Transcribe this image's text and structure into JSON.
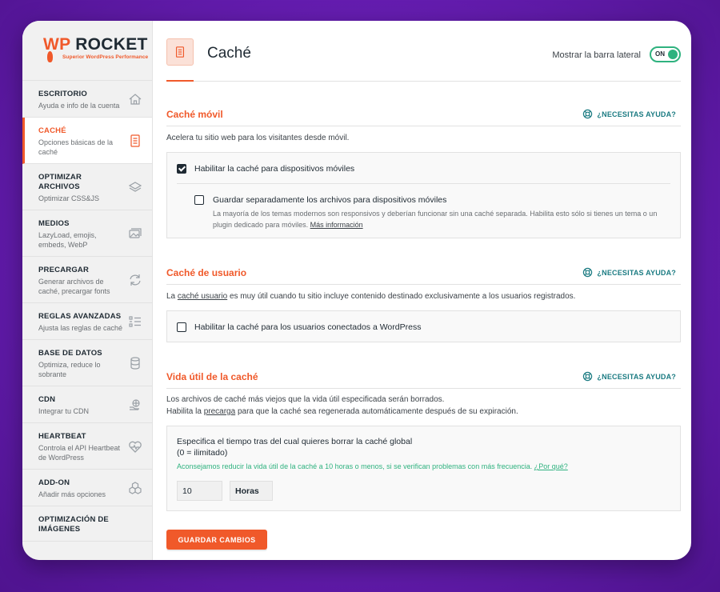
{
  "brand": {
    "wp": "WP",
    "rocket": "ROCKET",
    "tagline": "Superior WordPress Performance"
  },
  "sidebar": {
    "items": [
      {
        "title": "ESCRITORIO",
        "desc": "Ayuda e info de la cuenta",
        "icon": "home-icon"
      },
      {
        "title": "CACHÉ",
        "desc": "Opciones básicas de la caché",
        "icon": "page-icon",
        "active": true
      },
      {
        "title": "OPTIMIZAR ARCHIVOS",
        "desc": "Optimizar CSS&JS",
        "icon": "layers-icon"
      },
      {
        "title": "MEDIOS",
        "desc": "LazyLoad, emojis, embeds, WebP",
        "icon": "images-icon"
      },
      {
        "title": "PRECARGAR",
        "desc": "Generar archivos de caché, precargar fonts",
        "icon": "refresh-icon"
      },
      {
        "title": "REGLAS AVANZADAS",
        "desc": "Ajusta las reglas de caché",
        "icon": "list-icon"
      },
      {
        "title": "BASE DE DATOS",
        "desc": "Optimiza, reduce lo sobrante",
        "icon": "database-icon"
      },
      {
        "title": "CDN",
        "desc": "Integrar tu CDN",
        "icon": "cdn-icon"
      },
      {
        "title": "HEARTBEAT",
        "desc": "Controla el API Heartbeat de WordPress",
        "icon": "heartbeat-icon"
      },
      {
        "title": "ADD-ON",
        "desc": "Añadir más opciones",
        "icon": "addon-icon"
      },
      {
        "title": "OPTIMIZACIÓN DE IMÁGENES",
        "desc": "",
        "icon": ""
      }
    ]
  },
  "header": {
    "title": "Caché",
    "toggle_label": "Mostrar la barra lateral",
    "toggle_state": "ON"
  },
  "help_label": "¿NECESITAS AYUDA?",
  "mobile": {
    "title": "Caché móvil",
    "desc": "Acelera tu sitio web para los visitantes desde móvil.",
    "opt1": "Habilitar la caché para dispositivos móviles",
    "opt1_checked": true,
    "opt2": "Guardar separadamente los archivos para dispositivos móviles",
    "opt2_checked": false,
    "opt2_note": "La mayoría de los temas modernos son responsivos y deberían funcionar sin una caché separada. Habilita esto sólo si tienes un tema o un plugin dedicado para móviles.",
    "opt2_link": "Más información"
  },
  "user": {
    "title": "Caché de usuario",
    "desc_pre": "La",
    "desc_link": "caché usuario",
    "desc_post": "es muy útil cuando tu sitio incluye contenido destinado exclusivamente a los usuarios registrados.",
    "opt": "Habilitar la caché para los usuarios conectados a WordPress",
    "opt_checked": false
  },
  "lifespan": {
    "title": "Vida útil de la caché",
    "desc1": "Los archivos de caché más viejos que la vida útil especificada serán borrados.",
    "desc2_pre": "Habilita la",
    "desc2_link": "precarga",
    "desc2_post": "para que la caché sea regenerada automáticamente después de su expiración.",
    "field_label": "Especifica el tiempo tras del cual quieres borrar la caché global",
    "field_sub": "(0 = ilimitado)",
    "advice": "Aconsejamos reducir la vida útil de la caché a 10 horas o menos, si se verifican problemas con más frecuencia.",
    "advice_link": "¿Por qué?",
    "value": "10",
    "unit": "Horas"
  },
  "save_label": "GUARDAR CAMBIOS",
  "colors": {
    "accent": "#f0592a",
    "green": "#2fb27f",
    "teal": "#1b7b82",
    "dark": "#1f2a33"
  }
}
